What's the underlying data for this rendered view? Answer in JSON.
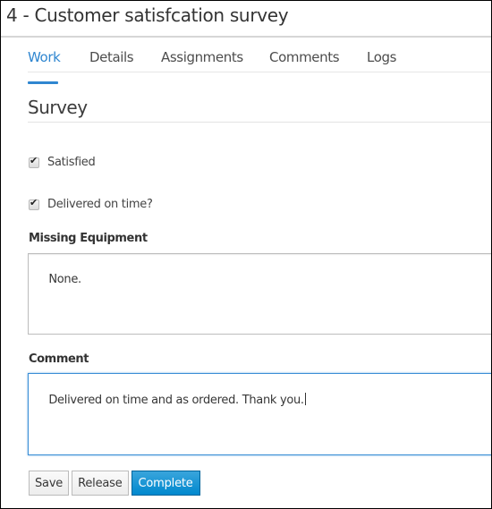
{
  "header": {
    "title": "4 - Customer satisfcation survey"
  },
  "tabs": [
    {
      "label": "Work",
      "active": true
    },
    {
      "label": "Details",
      "active": false
    },
    {
      "label": "Assignments",
      "active": false
    },
    {
      "label": "Comments",
      "active": false
    },
    {
      "label": "Logs",
      "active": false
    }
  ],
  "form": {
    "section_title": "Survey",
    "checkboxes": [
      {
        "label": "Satisfied",
        "checked": true
      },
      {
        "label": "Delivered on time?",
        "checked": true
      }
    ],
    "missing_equipment": {
      "label": "Missing Equipment",
      "value": "None."
    },
    "comment": {
      "label": "Comment",
      "value": "Delivered on time and as ordered. Thank you.",
      "focused": true
    }
  },
  "actions": {
    "save_label": "Save",
    "release_label": "Release",
    "complete_label": "Complete"
  },
  "colors": {
    "accent": "#2f86d0",
    "primary_button": "#0088ce"
  }
}
